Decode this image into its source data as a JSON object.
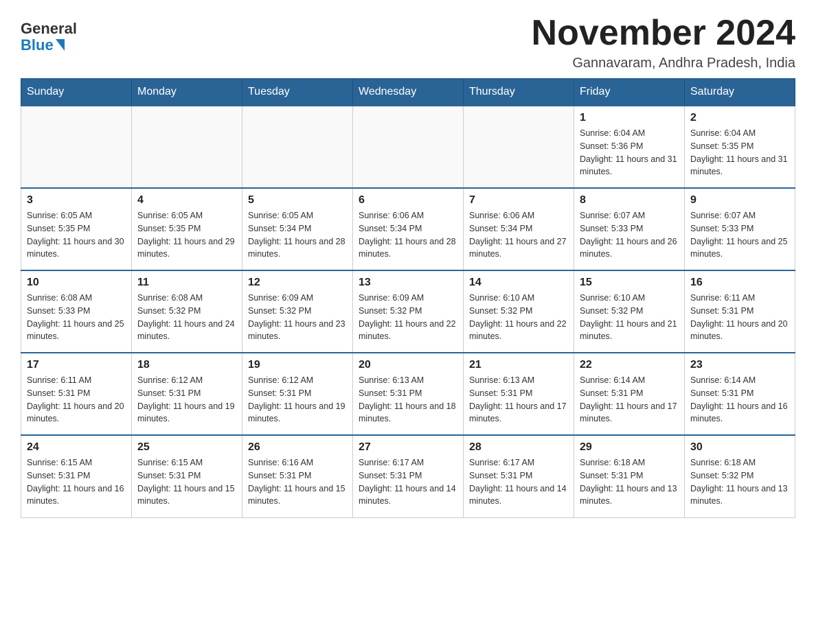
{
  "header": {
    "logo": {
      "text_general": "General",
      "text_blue": "Blue"
    },
    "title": "November 2024",
    "location": "Gannavaram, Andhra Pradesh, India"
  },
  "weekdays": [
    "Sunday",
    "Monday",
    "Tuesday",
    "Wednesday",
    "Thursday",
    "Friday",
    "Saturday"
  ],
  "weeks": [
    [
      {
        "day": "",
        "info": ""
      },
      {
        "day": "",
        "info": ""
      },
      {
        "day": "",
        "info": ""
      },
      {
        "day": "",
        "info": ""
      },
      {
        "day": "",
        "info": ""
      },
      {
        "day": "1",
        "info": "Sunrise: 6:04 AM\nSunset: 5:36 PM\nDaylight: 11 hours and 31 minutes."
      },
      {
        "day": "2",
        "info": "Sunrise: 6:04 AM\nSunset: 5:35 PM\nDaylight: 11 hours and 31 minutes."
      }
    ],
    [
      {
        "day": "3",
        "info": "Sunrise: 6:05 AM\nSunset: 5:35 PM\nDaylight: 11 hours and 30 minutes."
      },
      {
        "day": "4",
        "info": "Sunrise: 6:05 AM\nSunset: 5:35 PM\nDaylight: 11 hours and 29 minutes."
      },
      {
        "day": "5",
        "info": "Sunrise: 6:05 AM\nSunset: 5:34 PM\nDaylight: 11 hours and 28 minutes."
      },
      {
        "day": "6",
        "info": "Sunrise: 6:06 AM\nSunset: 5:34 PM\nDaylight: 11 hours and 28 minutes."
      },
      {
        "day": "7",
        "info": "Sunrise: 6:06 AM\nSunset: 5:34 PM\nDaylight: 11 hours and 27 minutes."
      },
      {
        "day": "8",
        "info": "Sunrise: 6:07 AM\nSunset: 5:33 PM\nDaylight: 11 hours and 26 minutes."
      },
      {
        "day": "9",
        "info": "Sunrise: 6:07 AM\nSunset: 5:33 PM\nDaylight: 11 hours and 25 minutes."
      }
    ],
    [
      {
        "day": "10",
        "info": "Sunrise: 6:08 AM\nSunset: 5:33 PM\nDaylight: 11 hours and 25 minutes."
      },
      {
        "day": "11",
        "info": "Sunrise: 6:08 AM\nSunset: 5:32 PM\nDaylight: 11 hours and 24 minutes."
      },
      {
        "day": "12",
        "info": "Sunrise: 6:09 AM\nSunset: 5:32 PM\nDaylight: 11 hours and 23 minutes."
      },
      {
        "day": "13",
        "info": "Sunrise: 6:09 AM\nSunset: 5:32 PM\nDaylight: 11 hours and 22 minutes."
      },
      {
        "day": "14",
        "info": "Sunrise: 6:10 AM\nSunset: 5:32 PM\nDaylight: 11 hours and 22 minutes."
      },
      {
        "day": "15",
        "info": "Sunrise: 6:10 AM\nSunset: 5:32 PM\nDaylight: 11 hours and 21 minutes."
      },
      {
        "day": "16",
        "info": "Sunrise: 6:11 AM\nSunset: 5:31 PM\nDaylight: 11 hours and 20 minutes."
      }
    ],
    [
      {
        "day": "17",
        "info": "Sunrise: 6:11 AM\nSunset: 5:31 PM\nDaylight: 11 hours and 20 minutes."
      },
      {
        "day": "18",
        "info": "Sunrise: 6:12 AM\nSunset: 5:31 PM\nDaylight: 11 hours and 19 minutes."
      },
      {
        "day": "19",
        "info": "Sunrise: 6:12 AM\nSunset: 5:31 PM\nDaylight: 11 hours and 19 minutes."
      },
      {
        "day": "20",
        "info": "Sunrise: 6:13 AM\nSunset: 5:31 PM\nDaylight: 11 hours and 18 minutes."
      },
      {
        "day": "21",
        "info": "Sunrise: 6:13 AM\nSunset: 5:31 PM\nDaylight: 11 hours and 17 minutes."
      },
      {
        "day": "22",
        "info": "Sunrise: 6:14 AM\nSunset: 5:31 PM\nDaylight: 11 hours and 17 minutes."
      },
      {
        "day": "23",
        "info": "Sunrise: 6:14 AM\nSunset: 5:31 PM\nDaylight: 11 hours and 16 minutes."
      }
    ],
    [
      {
        "day": "24",
        "info": "Sunrise: 6:15 AM\nSunset: 5:31 PM\nDaylight: 11 hours and 16 minutes."
      },
      {
        "day": "25",
        "info": "Sunrise: 6:15 AM\nSunset: 5:31 PM\nDaylight: 11 hours and 15 minutes."
      },
      {
        "day": "26",
        "info": "Sunrise: 6:16 AM\nSunset: 5:31 PM\nDaylight: 11 hours and 15 minutes."
      },
      {
        "day": "27",
        "info": "Sunrise: 6:17 AM\nSunset: 5:31 PM\nDaylight: 11 hours and 14 minutes."
      },
      {
        "day": "28",
        "info": "Sunrise: 6:17 AM\nSunset: 5:31 PM\nDaylight: 11 hours and 14 minutes."
      },
      {
        "day": "29",
        "info": "Sunrise: 6:18 AM\nSunset: 5:31 PM\nDaylight: 11 hours and 13 minutes."
      },
      {
        "day": "30",
        "info": "Sunrise: 6:18 AM\nSunset: 5:32 PM\nDaylight: 11 hours and 13 minutes."
      }
    ]
  ]
}
